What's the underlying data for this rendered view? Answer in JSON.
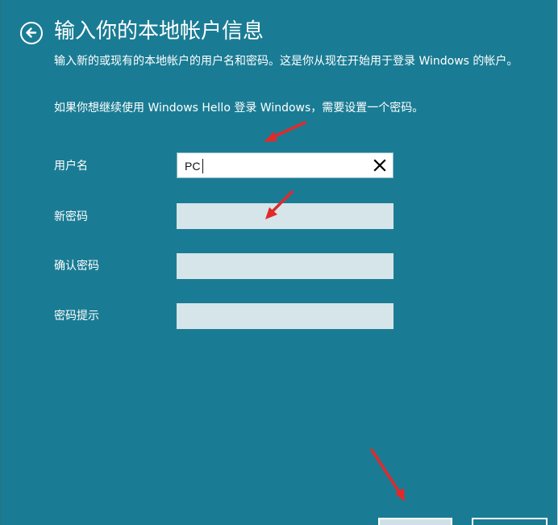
{
  "header": {
    "title": "输入你的本地帐户信息"
  },
  "description": {
    "line1": "输入新的或现有的本地帐户的用户名和密码。这是你从现在开始用于登录 Windows 的帐户。",
    "line2": "如果你想继续使用 Windows Hello 登录 Windows，需要设置一个密码。"
  },
  "form": {
    "username_label": "用户名",
    "username_value": "PC",
    "new_password_label": "新密码",
    "confirm_password_label": "确认密码",
    "password_hint_label": "密码提示"
  },
  "colors": {
    "background": "#1a7c94",
    "field_inactive": "#d6e5e9",
    "annotation_arrow": "#e02a2a"
  },
  "icons": {
    "back": "back-arrow-circle-icon",
    "clear": "close-icon"
  }
}
